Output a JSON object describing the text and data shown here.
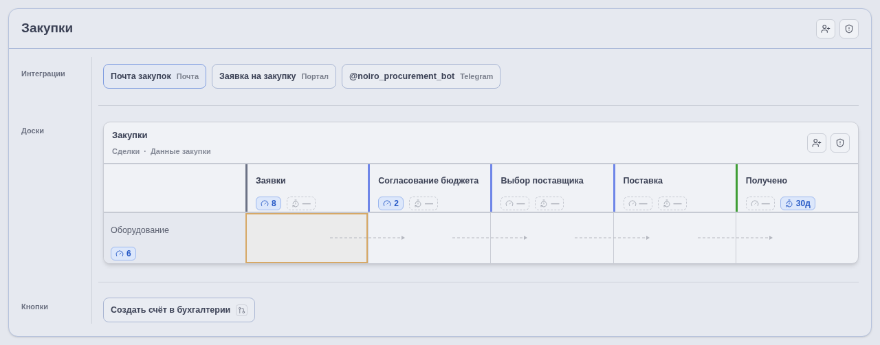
{
  "title": "Закупки",
  "sections": [
    {
      "label": "Интеграции"
    },
    {
      "label": "Доски"
    },
    {
      "label": "Кнопки"
    }
  ],
  "integrations": [
    {
      "name": "Почта закупок",
      "source": "Почта",
      "selected": true
    },
    {
      "name": "Заявка на закупку",
      "source": "Портал",
      "selected": false
    },
    {
      "name": "@noiro_procurement_bot",
      "source": "Telegram",
      "selected": false
    }
  ],
  "board": {
    "title": "Закупки",
    "crumbs": [
      "Сделки",
      "Данные закупки"
    ],
    "separator": "·",
    "stages": [
      {
        "name": "Заявки",
        "color": "#6b7285",
        "limit": {
          "value": "8",
          "active": true
        },
        "sla": {
          "value": "—",
          "active": false
        }
      },
      {
        "name": "Согласование бюджета",
        "color": "#6f86e8",
        "limit": {
          "value": "2",
          "active": true
        },
        "sla": {
          "value": "—",
          "active": false
        }
      },
      {
        "name": "Выбор поставщика",
        "color": "#6f86e8",
        "limit": {
          "value": "—",
          "active": false
        },
        "sla": {
          "value": "—",
          "active": false
        }
      },
      {
        "name": "Поставка",
        "color": "#6f86e8",
        "limit": {
          "value": "—",
          "active": false
        },
        "sla": {
          "value": "—",
          "active": false
        }
      },
      {
        "name": "Получено",
        "color": "#3f9e35",
        "limit": {
          "value": "—",
          "active": false
        },
        "sla": {
          "value": "30д",
          "active": true
        }
      }
    ],
    "rows": [
      {
        "name": "Оборудование",
        "limit": {
          "value": "6",
          "active": true
        },
        "cells": [
          {
            "selected": true
          },
          {
            "selected": false
          },
          {
            "selected": false
          },
          {
            "selected": false
          },
          {
            "selected": false
          }
        ]
      }
    ]
  },
  "buttons": [
    {
      "label": "Создать счёт в бухгалтерии"
    }
  ]
}
